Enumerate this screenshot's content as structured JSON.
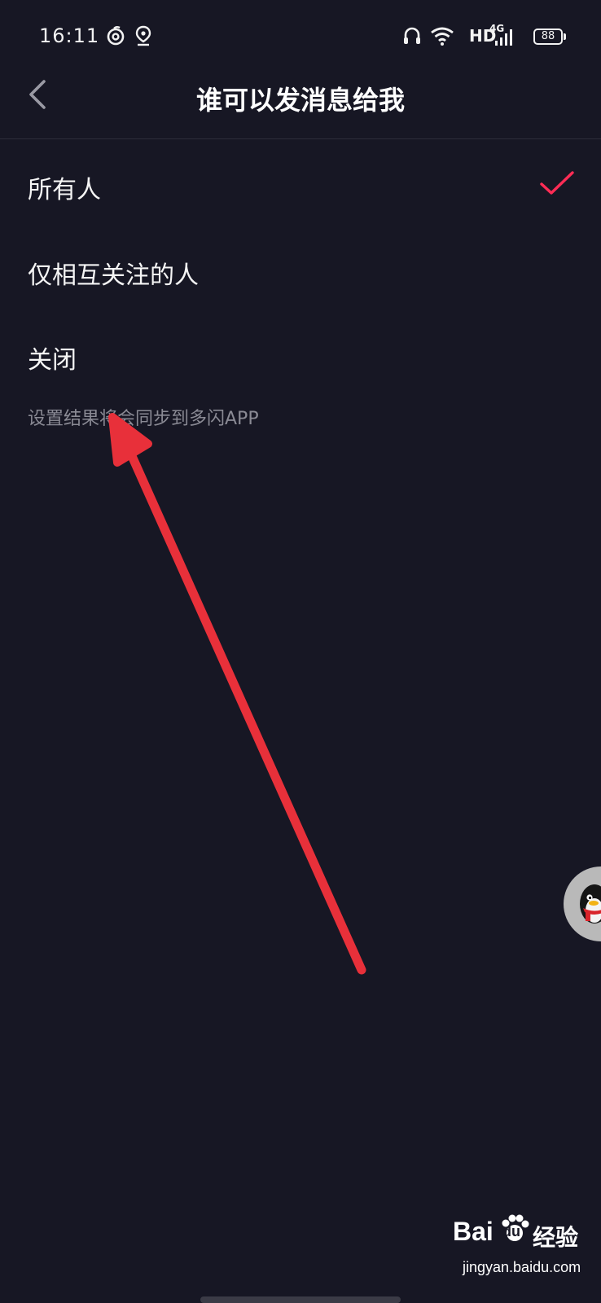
{
  "status_bar": {
    "time": "16:11",
    "network_label": "HD",
    "signal_label": "4G",
    "battery_level": "88",
    "icons": [
      "netease-music-icon",
      "location-icon",
      "headphones-icon",
      "wifi-icon",
      "signal-icon",
      "battery-icon"
    ]
  },
  "nav": {
    "back_icon": "chevron-left-icon",
    "title": "谁可以发消息给我"
  },
  "options": [
    {
      "label": "所有人",
      "selected": true
    },
    {
      "label": "仅相互关注的人",
      "selected": false
    },
    {
      "label": "关闭",
      "selected": false
    }
  ],
  "hint": "设置结果将会同步到多闪APP",
  "floating_button": {
    "icon": "qq-penguin-icon"
  },
  "watermark": {
    "brand_a": "Bai",
    "brand_b": "du",
    "brand_suffix": "经验",
    "domain": "jingyan.baidu.com"
  },
  "colors": {
    "background": "#171724",
    "accent": "#fe2c55",
    "annotation": "#e8303a",
    "hint_text": "#8a8a94"
  }
}
